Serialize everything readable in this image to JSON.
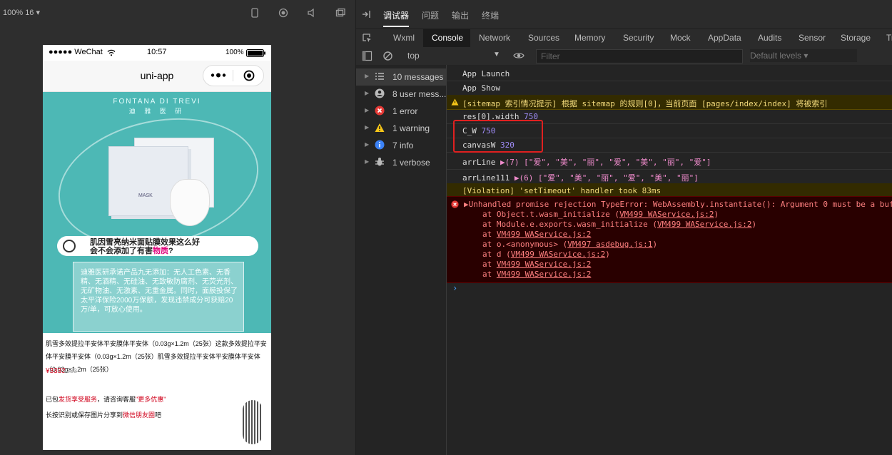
{
  "simulator": {
    "zoom": "100% 16 ▾",
    "status": {
      "carrier": "●●●●● WeChat",
      "time": "10:57",
      "battery": "100%"
    },
    "nav_title": "uni-app",
    "banner": {
      "brand_en": "FONTANA DI TREVI",
      "brand_cn": "迪 雅 医 研",
      "mask_label": "MASK",
      "question_line1": "肌因雪亮纳米面贴膜效果这么好",
      "question_line2_a": "会不会添加了有害",
      "question_line2_b": "物质",
      "question_line2_c": "?",
      "panel_text": "迪雅医研承诺产品九无添加：无人工色素、无香精、无酒精、无硅油、无致敏防腐剂、无荧光剂、无矿物油、无激素、无重金属。同时，面膜投保了太平洋保险2000万保额，发现违禁成分可获赔20万/单，可放心使用。"
    },
    "product": {
      "desc": "肌雪多效提拉平安体平安膜体平安体（0.03g×1.2m（25张）这款多效提拉平安体平安膜平安体（0.03g×1.2m（25张）肌雪多效提拉平安体平安膜体平安体（0.03g×1.2m（25张）",
      "price": "¥3333",
      "old_price": "¥333",
      "note1_a": "已包",
      "note1_b": "发货享受服务",
      "note1_c": "，请咨询客服",
      "note1_d": "\"更多优惠\"",
      "note2_a": "长按识别或保存图片分享到",
      "note2_b": "微信朋友圈",
      "note2_c": "吧"
    }
  },
  "devtools": {
    "top_tabs": [
      "调试器",
      "问题",
      "输出",
      "终端"
    ],
    "panel_tabs": [
      "Wxml",
      "Console",
      "Network",
      "Sources",
      "Memory",
      "Security",
      "Mock",
      "AppData",
      "Audits",
      "Sensor",
      "Storage",
      "Tr"
    ],
    "context": "top",
    "filter_placeholder": "Filter",
    "levels": "Default levels ▾",
    "sidebar": [
      {
        "label": "10 messages",
        "icon": "list-icon"
      },
      {
        "label": "8 user mess...",
        "icon": "user-icon"
      },
      {
        "label": "1 error",
        "icon": "error-icon"
      },
      {
        "label": "1 warning",
        "icon": "warning-icon"
      },
      {
        "label": "7 info",
        "icon": "info-icon"
      },
      {
        "label": "1 verbose",
        "icon": "bug-icon"
      }
    ],
    "console": {
      "l1": "App Launch",
      "l2": "App Show",
      "l3": "[sitemap 索引情况提示] 根据 sitemap 的规则[0]，当前页面 [pages/index/index] 将被索引",
      "l4_key": "res[0].width",
      "l4_val": "750",
      "l5_key": "C_W",
      "l5_val": "750",
      "l6_key": "canvasW",
      "l6_val": "320",
      "l7_key": "arrLine",
      "l7_val": "▶(7) [\"爱\", \"美\", \"丽\", \"爱\", \"美\", \"丽\", \"爱\"]",
      "l8_key": "arrLine111",
      "l8_val": "▶(6) [\"爱\", \"美\", \"丽\", \"爱\", \"美\", \"丽\"]",
      "l9": "[Violation] 'setTimeout' handler took 83ms",
      "err_head": "▶Unhandled promise rejection TypeError: WebAssembly.instantiate(): Argument 0 must be a buf",
      "err_1a": "at Object.t.wasm_initialize (",
      "err_1b": "VM499 WAService.js:2",
      "err_1c": ")",
      "err_2a": "at Module.e.exports.wasm_initialize (",
      "err_2b": "VM499 WAService.js:2",
      "err_2c": ")",
      "err_3a": "at ",
      "err_3b": "VM499 WAService.js:2",
      "err_4a": "at o.<anonymous> (",
      "err_4b": "VM497 asdebug.js:1",
      "err_4c": ")",
      "err_5a": "at d (",
      "err_5b": "VM499 WAService.js:2",
      "err_5c": ")",
      "err_6a": "at ",
      "err_6b": "VM499 WAService.js:2",
      "err_7a": "at ",
      "err_7b": "VM499 WAService.js:2",
      "prompt": "›"
    }
  }
}
